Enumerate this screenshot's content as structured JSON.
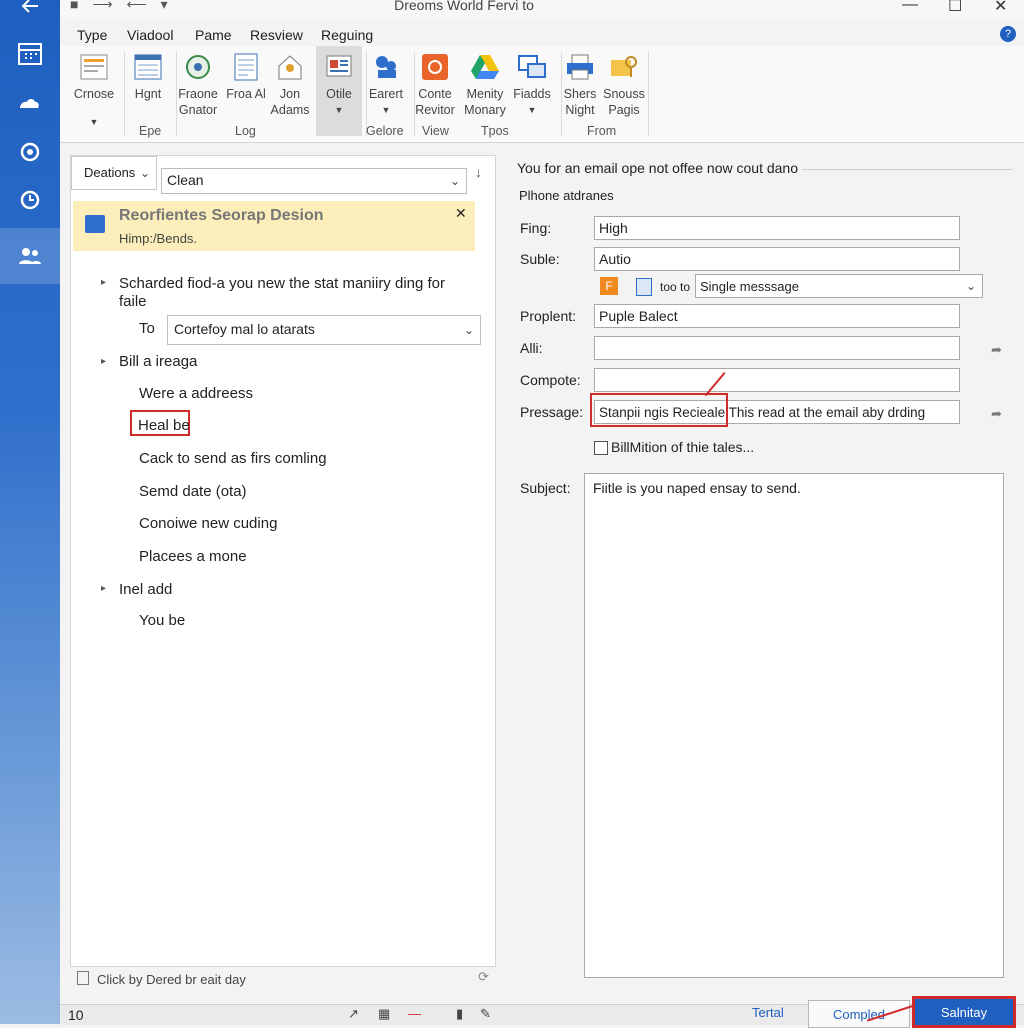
{
  "window": {
    "title": "Dreoms World Fervi to"
  },
  "menu_tabs": [
    "Type",
    "Viadool",
    "Pame",
    "Resview",
    "Reguing"
  ],
  "ribbon": {
    "buttons": [
      {
        "label": "Crnose"
      },
      {
        "label": "Hgnt"
      },
      {
        "label": "Fraone Gnator"
      },
      {
        "label": "Froa Al"
      },
      {
        "label": "Jon Adams"
      },
      {
        "label": "Otile"
      },
      {
        "label": "Earert"
      },
      {
        "label": "Conte Revitor"
      },
      {
        "label": "Menity Monary"
      },
      {
        "label": "Fiadds"
      },
      {
        "label": "Shers Night"
      },
      {
        "label": "Snouss Pagis"
      }
    ],
    "groups": [
      "Epe",
      "Log",
      "Gelore",
      "View",
      "Tpos",
      "From"
    ]
  },
  "left_pane": {
    "view_dropdown": "Deations",
    "filter_value": "Clean",
    "notice_title": "Reorfientes Seorap Desion",
    "notice_subtitle": "Himp:/Bends.",
    "tree": [
      {
        "text": "Scharded fiod-a you new the stat maniiry ding for faile"
      },
      {
        "text": "To"
      },
      {
        "text": "Bill a ireaga"
      },
      {
        "text": "Were a addreess"
      },
      {
        "text": "Heal be"
      },
      {
        "text": "Cack to send as firs comling"
      },
      {
        "text": "Semd date (ota)"
      },
      {
        "text": "Conoiwe new cuding"
      },
      {
        "text": "Placees a mone"
      },
      {
        "text": "Inel add"
      },
      {
        "text": "You be"
      }
    ],
    "to_dropdown": "Cortefoy mal lo atarats",
    "footer_text": "Click by Dered br eait day"
  },
  "right_pane": {
    "header": "You for an email ope not offee now cout dano",
    "section": "Plhone atdranes",
    "fields": {
      "fing_label": "Fing:",
      "fing_value": "High",
      "suble_label": "Suble:",
      "suble_value": "Autio",
      "too_to_label": "too to",
      "too_to_value": "Single messsage",
      "proplent_label": "Proplent:",
      "proplent_value": "Puple Balect",
      "alli_label": "Alli:",
      "alli_value": "",
      "compote_label": "Compote:",
      "compote_value": "",
      "pressage_label": "Pressage:",
      "pressage_value": "Stanpii ngis Recieale This read at the email aby drding"
    },
    "checkbox_label": "BillMition of thie tales...",
    "subject_label": "Subject:",
    "subject_body": "Fiitle is you naped ensay to send.",
    "buttons": {
      "tertial": "Tertal",
      "compled": "Compled",
      "submit": "Salnitay"
    }
  },
  "status": {
    "page_number": "10"
  },
  "colors": {
    "accent": "#1e5fbf",
    "highlight_red": "#d12a2a",
    "notice": "#fbeebb"
  }
}
